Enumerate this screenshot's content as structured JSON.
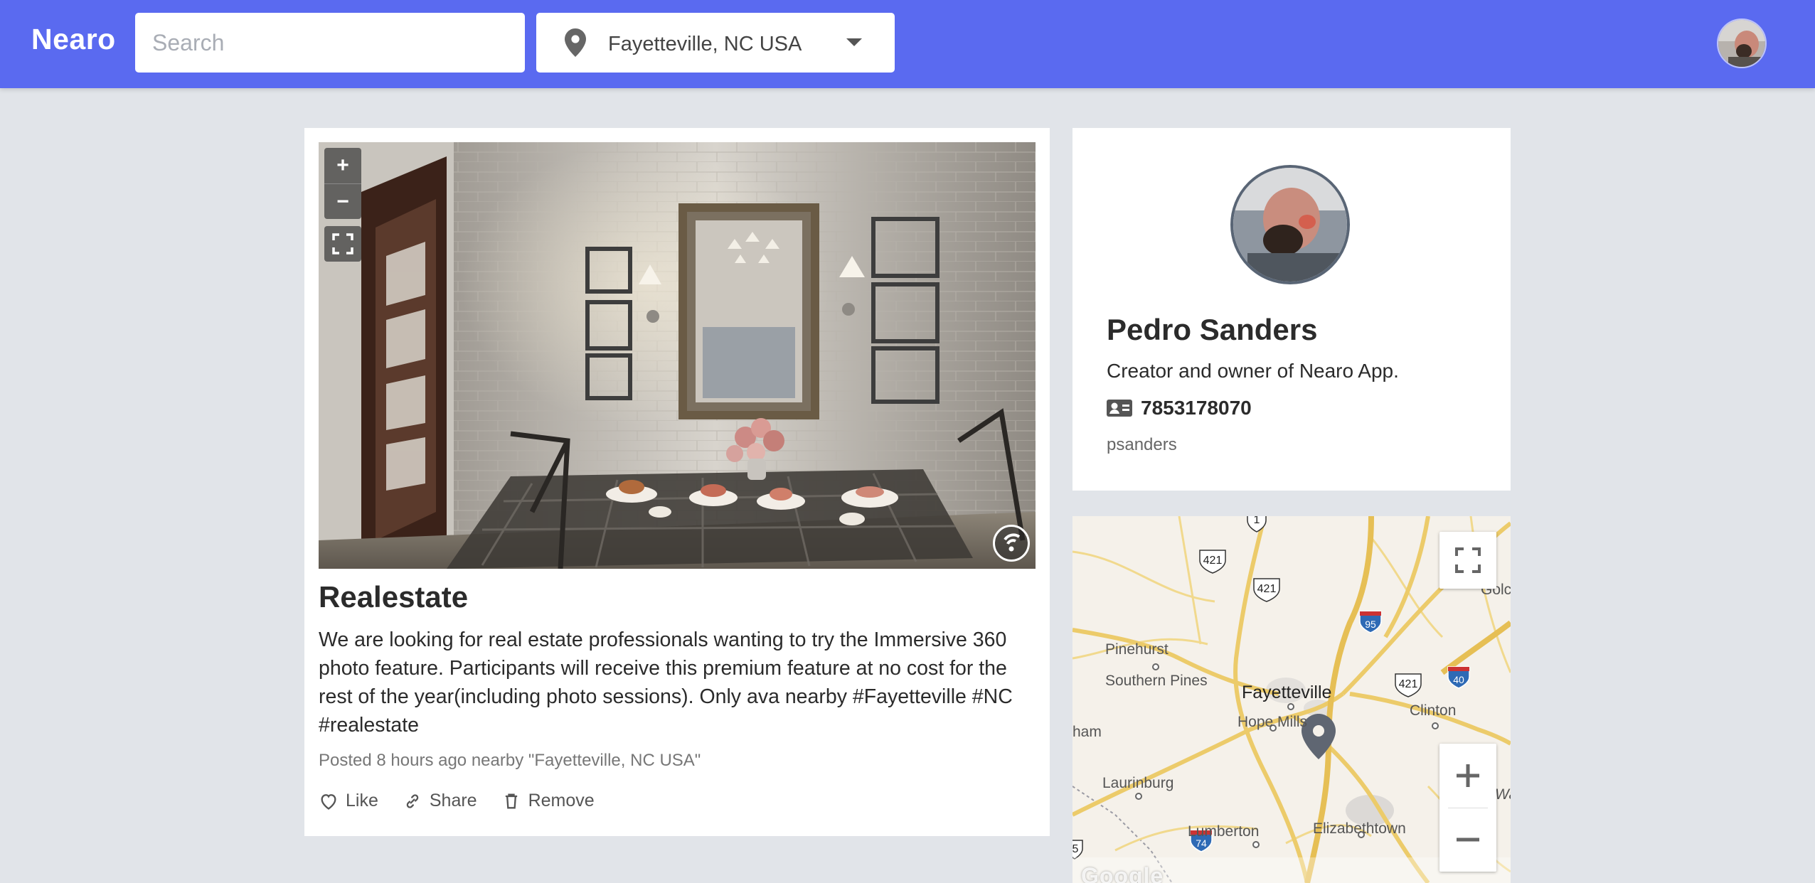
{
  "app": {
    "brand": "Nearo"
  },
  "search": {
    "placeholder": "Search",
    "value": ""
  },
  "location_select": {
    "selected": "Fayetteville, NC USA"
  },
  "post": {
    "title": "Realestate",
    "body": "We are looking for real estate professionals wanting to try the Immersive 360 photo feature. Participants will receive this premium feature at no cost for the rest of the year(including photo sessions). Only ava nearby #Fayetteville #NC #realestate",
    "meta": "Posted 8 hours ago nearby \"Fayetteville, NC USA\"",
    "actions": {
      "like": "Like",
      "share": "Share",
      "remove": "Remove"
    },
    "viewer": {
      "zoom_in": "+",
      "zoom_out": "−"
    }
  },
  "profile": {
    "name": "Pedro Sanders",
    "bio": "Creator and owner of Nearo App.",
    "phone": "7853178070",
    "handle": "psanders"
  },
  "map": {
    "labels": {
      "pinehurst": "Pinehurst",
      "southern_pines": "Southern Pines",
      "fayetteville": "Fayetteville",
      "hope_mills": "Hope Mills",
      "clinton": "Clinton",
      "laurinburg": "Laurinburg",
      "lumberton": "Lumberton",
      "elizabethtown": "Elizabethtown",
      "ham": "ham",
      "golc": "Golc",
      "wa": "Wa",
      "google": "Google"
    },
    "shields": {
      "us1": "1",
      "us421a": "421",
      "us421b": "421",
      "us421c": "421",
      "i95": "95",
      "i40": "40",
      "i74": "74",
      "r5": "5"
    }
  },
  "colors": {
    "topbar": "#5a6af0",
    "background": "#e1e4e9"
  }
}
